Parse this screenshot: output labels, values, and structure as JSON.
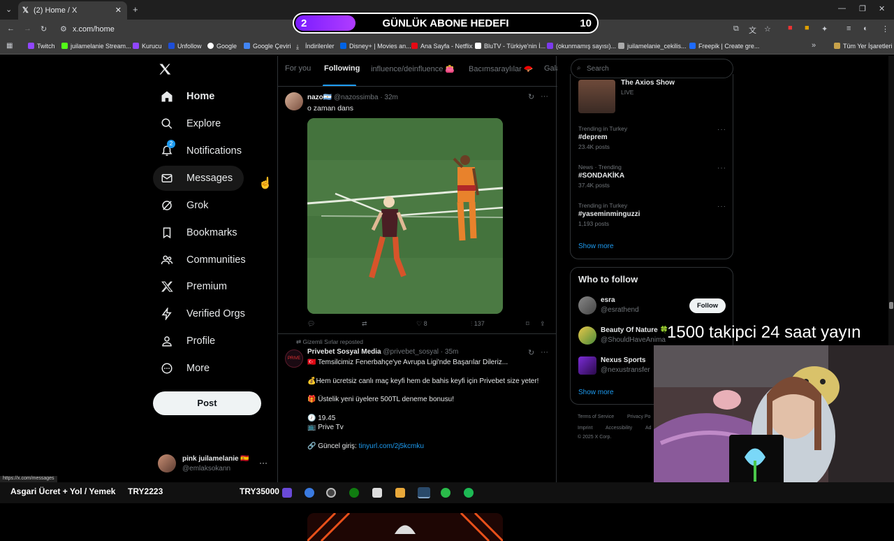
{
  "browser": {
    "tab_title": "(2) Home / X",
    "url": "x.com/home",
    "status_url": "https://x.com/messages",
    "bookmarks": [
      "Twitch",
      "juilamelanie Stream...",
      "Kurucu",
      "Unfollow",
      "Google",
      "Google Çeviri",
      "İndirilenler",
      "Disney+ | Movies an...",
      "Ana Sayfa - Netflix",
      "BluTV - Türkiye'nin İ...",
      "(okunmamış sayısı)...",
      "juilamelanie_cekilis...",
      "Freepik | Create gre..."
    ],
    "all_bookmarks": "Tüm Yer İşaretleri"
  },
  "overlay": {
    "goal_current": "2",
    "goal_title": "GÜNLÜK ABONE HEDEFI",
    "goal_target": "10",
    "goal_progress": 0.2,
    "banner_text": "1500 takipci 24 saat yayın",
    "taskbar_text1": "Asgari Ücret + Yol / Yemek",
    "taskbar_text2": "TRY2223",
    "taskbar_text3": "TRY35000"
  },
  "nav": {
    "home": "Home",
    "explore": "Explore",
    "notifications": "Notifications",
    "notif_badge": "2",
    "messages": "Messages",
    "grok": "Grok",
    "bookmarks": "Bookmarks",
    "communities": "Communities",
    "premium": "Premium",
    "verified_orgs": "Verified Orgs",
    "profile": "Profile",
    "more": "More",
    "post": "Post",
    "account_name": "pink juilamelanie 🇪🇸",
    "account_handle": "@emlaksokann"
  },
  "timeline": {
    "tabs": [
      "For you",
      "Following",
      "influence/deinfluence 👛",
      "Bacımsaraylılar 🪭",
      "Gala"
    ],
    "post1": {
      "name": "nazo🇦🇷",
      "handle": "@nazossimba",
      "time": "· 32m",
      "text": "o zaman dans",
      "likes": "8",
      "views": "137"
    },
    "post2": {
      "repost_by": "Gizemli Sırlar reposted",
      "name": "Privebet Sosyal Media",
      "handle": "@privebet_sosyal",
      "time": "· 35m",
      "line1": "🇹🇷 Temsilcimiz Fenerbahçe'ye Avrupa Ligi'nde Başarılar Dileriz...",
      "line2": "💰Hem ücretsiz canlı maç keyfi hem de bahis keyfi için Privebet size yeter!",
      "line3": "🎁 Üstelik yeni üyelere 500TL deneme bonusu!",
      "line4": "🕖 19.45",
      "line5": "📺 Prive Tv",
      "line6_label": "🔗 Güncel giriş: ",
      "line6_link": "tinyurl.com/2j5kcmku"
    }
  },
  "right": {
    "search_placeholder": "Search",
    "live_title": "The Axios Show",
    "live_label": "LIVE",
    "trends": [
      {
        "context": "Trending in Turkey",
        "tag": "#deprem",
        "posts": "23.4K posts"
      },
      {
        "context": "News · Trending",
        "tag": "#SONDAKİKA",
        "posts": "37.4K posts"
      },
      {
        "context": "Trending in Turkey",
        "tag": "#yaseminminguzzi",
        "posts": "1,193 posts"
      }
    ],
    "show_more": "Show more",
    "who_to_follow": "Who to follow",
    "follow_label": "Follow",
    "suggestions": [
      {
        "name": "esra",
        "handle": "@esrathend"
      },
      {
        "name": "Beauty Of Nature 🍀",
        "handle": "@ShouldHaveAnima"
      },
      {
        "name": "Nexus Sports",
        "handle": "@nexustransfer"
      }
    ],
    "footer1": "Terms of Service",
    "footer2": "Privacy Po",
    "footer3": "Imprint",
    "footer4": "Accessibility",
    "footer5": "Ad",
    "footer6": "© 2025 X Corp."
  }
}
